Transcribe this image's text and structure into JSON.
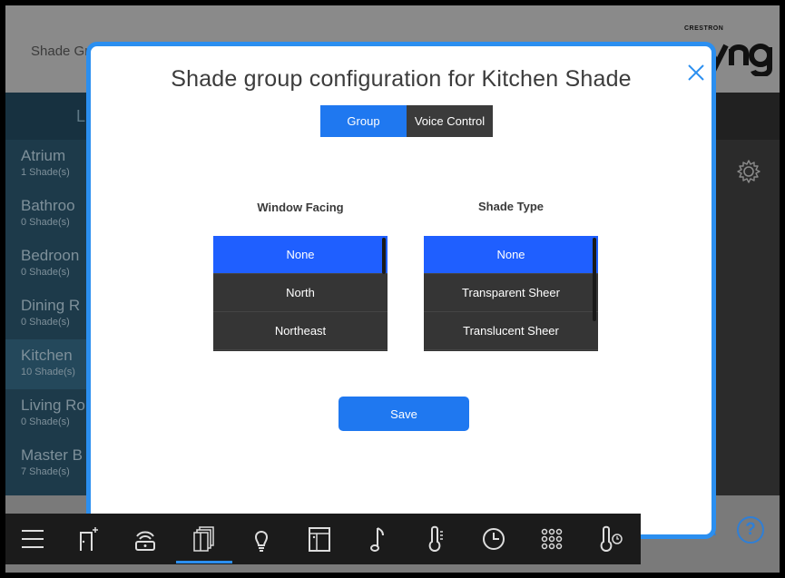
{
  "background": {
    "app_title": "Shade Gr",
    "brand_small": "CRESTRON",
    "brand_big": "ynq",
    "rooms": [
      {
        "name": "Atrium",
        "count": "1 Shade(s)"
      },
      {
        "name": "Bathroo",
        "count": "0 Shade(s)"
      },
      {
        "name": "Bedroon",
        "count": "0 Shade(s)"
      },
      {
        "name": "Dining R",
        "count": "0 Shade(s)"
      },
      {
        "name": "Kitchen",
        "count": "10 Shade(s)"
      },
      {
        "name": "Living Ro",
        "count": "0 Shade(s)"
      },
      {
        "name": "Master B",
        "count": "7 Shade(s)"
      }
    ],
    "left_header": "L",
    "help_label": "?"
  },
  "modal": {
    "title": "Shade group configuration for Kitchen Shade",
    "tabs": [
      {
        "label": "Group",
        "active": true
      },
      {
        "label": "Voice Control",
        "active": false
      }
    ],
    "window_facing": {
      "label": "Window Facing",
      "options": [
        "None",
        "North",
        "Northeast"
      ],
      "selected": "None"
    },
    "shade_type": {
      "label": "Shade Type",
      "options": [
        "None",
        "Transparent Sheer",
        "Translucent Sheer"
      ],
      "selected": "None"
    },
    "save_label": "Save"
  },
  "nav": {
    "items": [
      "menu-icon",
      "add-device-icon",
      "gateway-icon",
      "shades-icon",
      "light-bulb-icon",
      "door-icon",
      "music-icon",
      "thermostat-icon",
      "clock-icon",
      "keypad-icon",
      "temperature-sensor-icon"
    ],
    "active": "shades-icon"
  },
  "colors": {
    "accent": "#2b8ff0",
    "selected": "#1f5fff",
    "dark": "#353535"
  }
}
